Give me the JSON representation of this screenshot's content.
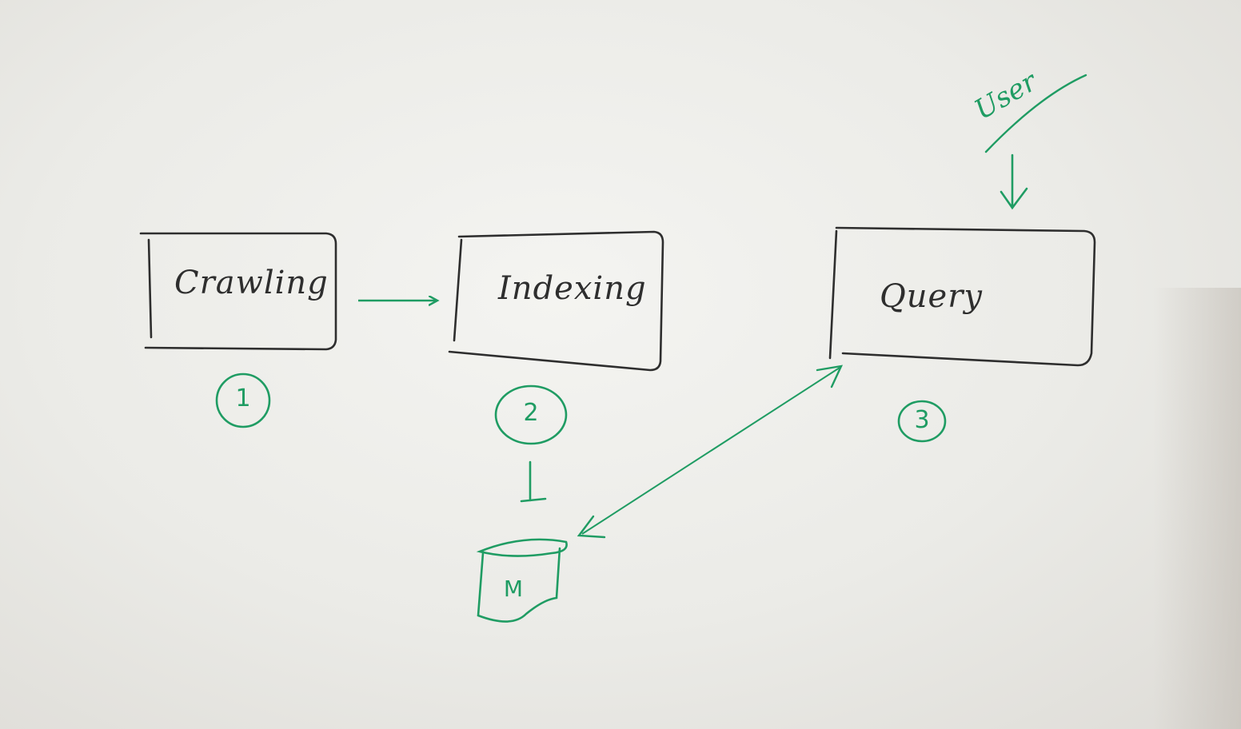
{
  "steps": [
    {
      "label": "Crawling",
      "number": "1"
    },
    {
      "label": "Indexing",
      "number": "2"
    },
    {
      "label": "Query",
      "number": "3"
    }
  ],
  "user_label": "User",
  "storage_label": "M",
  "colors": {
    "ink": "#2e2e2e",
    "marker": "#1f9c63",
    "board": "#eeeeeb"
  }
}
